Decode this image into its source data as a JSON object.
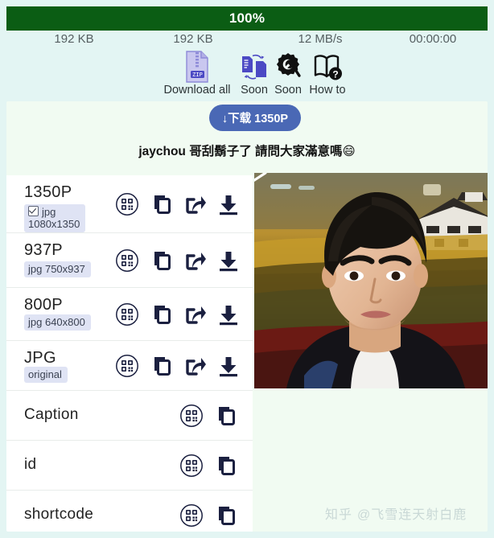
{
  "progress": {
    "percent_label": "100%",
    "percent_value": 100,
    "bar_color": "#0b5d14"
  },
  "stats": [
    {
      "name": "downloaded-size",
      "value": "192 KB"
    },
    {
      "name": "total-size",
      "value": "192 KB"
    },
    {
      "name": "speed",
      "value": "12 MB/s"
    },
    {
      "name": "elapsed-time",
      "value": "00:00:00"
    }
  ],
  "tools": [
    {
      "icon": "zip-file-icon",
      "label": "Download all"
    },
    {
      "icon": "file-convert-icon",
      "label": "Soon"
    },
    {
      "icon": "gear-wrench-icon",
      "label": "Soon"
    },
    {
      "icon": "book-question-icon",
      "label": "How to"
    }
  ],
  "download_button": {
    "label": "↓下载 1350P",
    "color": "#4a68b5"
  },
  "post": {
    "caption": "jaychou 哥刮鬍子了 請問大家滿意嗎😄"
  },
  "rows": [
    {
      "title": "1350P",
      "badge": "jpg",
      "badge_sub": "1080x1350",
      "checkbox": true,
      "actions": [
        "qr-code-icon",
        "copy-icon",
        "share-icon",
        "download-icon"
      ]
    },
    {
      "title": "937P",
      "badge": "jpg 750x937",
      "badge_sub": "",
      "checkbox": false,
      "actions": [
        "qr-code-icon",
        "copy-icon",
        "share-icon",
        "download-icon"
      ]
    },
    {
      "title": "800P",
      "badge": "jpg 640x800",
      "badge_sub": "",
      "checkbox": false,
      "actions": [
        "qr-code-icon",
        "copy-icon",
        "share-icon",
        "download-icon"
      ]
    },
    {
      "title": "JPG",
      "badge": "original",
      "badge_sub": "",
      "checkbox": false,
      "actions": [
        "qr-code-icon",
        "copy-icon",
        "share-icon",
        "download-icon"
      ]
    },
    {
      "title": "Caption",
      "badge": "",
      "badge_sub": "",
      "checkbox": false,
      "actions": [
        "qr-code-icon",
        "copy-icon"
      ]
    },
    {
      "title": "id",
      "badge": "",
      "badge_sub": "",
      "checkbox": false,
      "actions": [
        "qr-code-icon",
        "copy-icon"
      ]
    },
    {
      "title": "shortcode",
      "badge": "",
      "badge_sub": "",
      "checkbox": false,
      "actions": [
        "qr-code-icon",
        "copy-icon"
      ]
    }
  ],
  "media": {
    "name": "video-thumbnail",
    "play_icon": "play-triangle-icon"
  },
  "annotation": {
    "name": "red-arrow",
    "color": "#e03b2f"
  },
  "watermark": {
    "logo": "知乎",
    "handle": "@飞雪连天射白鹿"
  }
}
